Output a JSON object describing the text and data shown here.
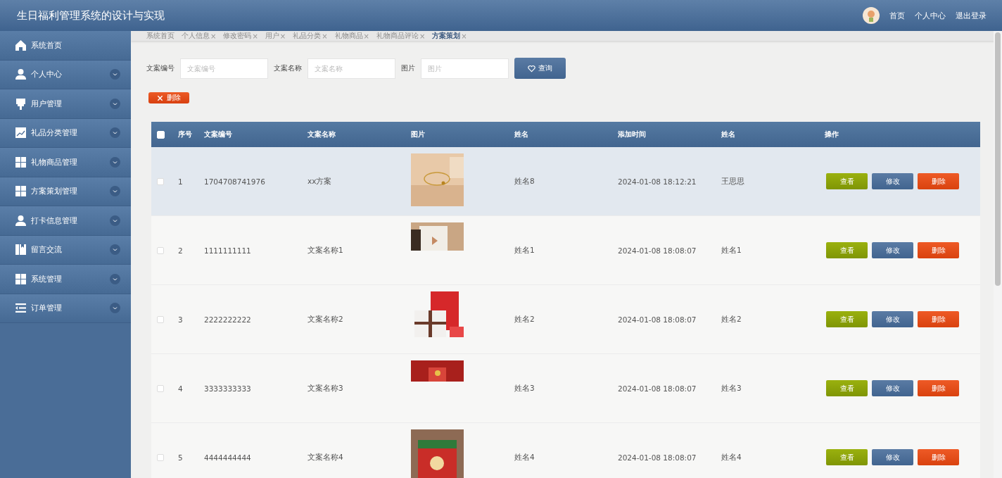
{
  "header": {
    "title": "生日福利管理系统的设计与实现",
    "links": [
      "首页",
      "个人中心",
      "退出登录"
    ]
  },
  "sidebar": {
    "items": [
      {
        "label": "系统首页",
        "expandable": false
      },
      {
        "label": "个人中心",
        "expandable": true
      },
      {
        "label": "用户管理",
        "expandable": true
      },
      {
        "label": "礼品分类管理",
        "expandable": true
      },
      {
        "label": "礼物商品管理",
        "expandable": true
      },
      {
        "label": "方案策划管理",
        "expandable": true
      },
      {
        "label": "打卡信息管理",
        "expandable": true
      },
      {
        "label": "留言交流",
        "expandable": true
      },
      {
        "label": "系统管理",
        "expandable": true
      },
      {
        "label": "订单管理",
        "expandable": true
      }
    ]
  },
  "tabs": [
    {
      "label": "系统首页",
      "selected": false
    },
    {
      "label": "个人信息",
      "close": "×",
      "selected": false
    },
    {
      "label": "修改密码",
      "close": "×",
      "selected": false
    },
    {
      "label": "用户",
      "close": "×",
      "selected": false
    },
    {
      "label": "礼品分类",
      "close": "×",
      "selected": false
    },
    {
      "label": "礼物商品",
      "close": "×",
      "selected": false
    },
    {
      "label": "礼物商品评论",
      "close": "×",
      "selected": false
    },
    {
      "label": "方案策划",
      "close": "×",
      "selected": true
    }
  ],
  "search": {
    "fields": [
      {
        "label": "文案编号",
        "placeholder": "文案编号"
      },
      {
        "label": "文案名称",
        "placeholder": "文案名称"
      },
      {
        "label": "图片",
        "placeholder": "图片"
      }
    ],
    "button": "查询"
  },
  "delete_button": "删除",
  "table": {
    "columns": [
      "序号",
      "文案编号",
      "文案名称",
      "图片",
      "姓名",
      "添加时间",
      "姓名",
      "操作"
    ],
    "select_all_checked": false,
    "rows": [
      {
        "selected": true,
        "checked": false,
        "cells": [
          "1",
          "1704708741976",
          "xx方案",
          "",
          "姓名8",
          "2024-01-08 18:12:21",
          "王思思"
        ],
        "picture": {
          "kind": "picture"
        },
        "actions": [
          "查看",
          "修改",
          "删除"
        ]
      },
      {
        "selected": false,
        "checked": false,
        "cells": [
          "2",
          "1111111111",
          "文案名称1",
          "",
          "姓名1",
          "2024-01-08 18:08:07",
          "姓名1"
        ],
        "picture": {
          "kind": "picture"
        },
        "actions": [
          "查看",
          "修改",
          "删除"
        ]
      },
      {
        "selected": false,
        "checked": false,
        "cells": [
          "3",
          "2222222222",
          "文案名称2",
          "",
          "姓名2",
          "2024-01-08 18:08:07",
          "姓名2"
        ],
        "picture": {
          "kind": "picture"
        },
        "actions": [
          "查看",
          "修改",
          "删除"
        ]
      },
      {
        "selected": false,
        "checked": false,
        "cells": [
          "4",
          "3333333333",
          "文案名称3",
          "",
          "姓名3",
          "2024-01-08 18:08:07",
          "姓名3"
        ],
        "picture": {
          "kind": "picture"
        },
        "actions": [
          "查看",
          "修改",
          "删除"
        ]
      },
      {
        "selected": false,
        "checked": false,
        "cells": [
          "5",
          "4444444444",
          "文案名称4",
          "",
          "姓名4",
          "2024-01-08 18:08:07",
          "姓名4"
        ],
        "picture": {
          "kind": "picture"
        },
        "actions": [
          "查看",
          "修改",
          "删除"
        ]
      }
    ]
  }
}
